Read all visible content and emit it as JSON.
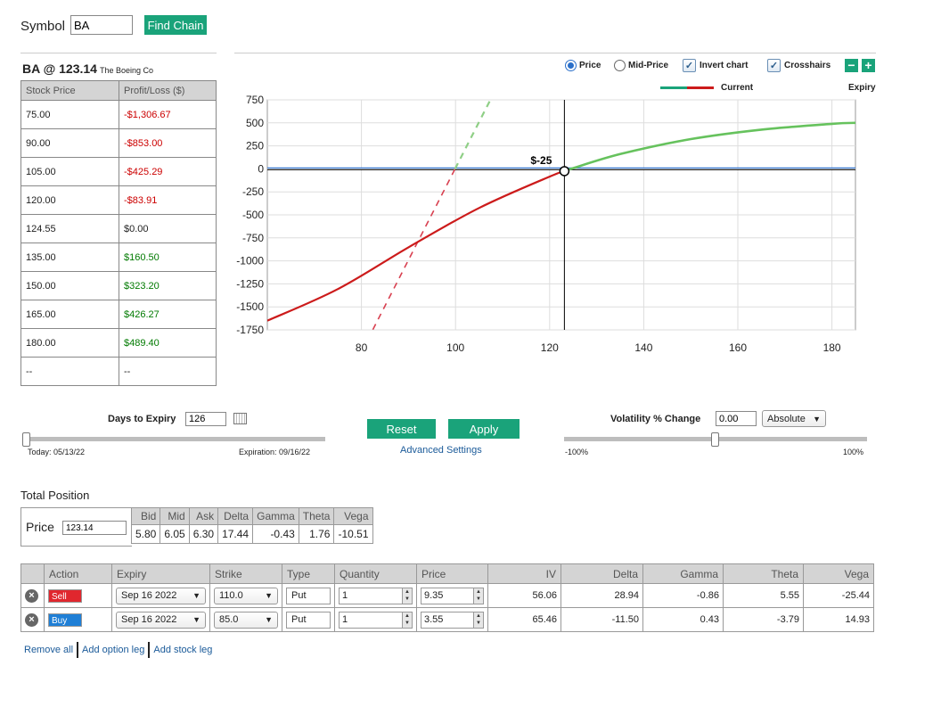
{
  "symbol": {
    "label": "Symbol",
    "value": "BA",
    "find_button": "Find Chain"
  },
  "quote": {
    "ticker_price": "BA @ 123.14",
    "company": "The Boeing Co"
  },
  "pl_table": {
    "headers": [
      "Stock Price",
      "Profit/Loss ($)"
    ],
    "rows": [
      {
        "price": "75.00",
        "pl": "-$1,306.67",
        "sign": "neg"
      },
      {
        "price": "90.00",
        "pl": "-$853.00",
        "sign": "neg"
      },
      {
        "price": "105.00",
        "pl": "-$425.29",
        "sign": "neg"
      },
      {
        "price": "120.00",
        "pl": "-$83.91",
        "sign": "neg"
      },
      {
        "price": "124.55",
        "pl": "$0.00",
        "sign": "zero"
      },
      {
        "price": "135.00",
        "pl": "$160.50",
        "sign": "pos"
      },
      {
        "price": "150.00",
        "pl": "$323.20",
        "sign": "pos"
      },
      {
        "price": "165.00",
        "pl": "$426.27",
        "sign": "pos"
      },
      {
        "price": "180.00",
        "pl": "$489.40",
        "sign": "pos"
      },
      {
        "price": "--",
        "pl": "--",
        "sign": "zero"
      }
    ]
  },
  "chart_controls": {
    "price_radio": "Price",
    "mid_price_radio": "Mid-Price",
    "invert_chart": "Invert chart",
    "crosshairs": "Crosshairs",
    "legend_current": "Current",
    "legend_expiry": "Expiry",
    "colors": {
      "current_loss": "#cc1b1b",
      "current_gain": "#66c25d",
      "expiry_loss": "#d84050",
      "expiry_gain": "#8fcf86",
      "zero_line": "#3a7bd5",
      "accent": "#1aa37a"
    }
  },
  "chart_data": {
    "type": "line",
    "xlim": [
      60,
      185
    ],
    "ylim": [
      -1750,
      750
    ],
    "x_ticks": [
      80,
      100,
      120,
      140,
      160,
      180
    ],
    "y_ticks": [
      750,
      500,
      250,
      0,
      -250,
      -500,
      -750,
      -1000,
      -1250,
      -1500,
      -1750
    ],
    "series": [
      {
        "name": "Current",
        "x": [
          60,
          75,
          90,
          105,
          120,
          123.14,
          124.55,
          135,
          150,
          165,
          180,
          185
        ],
        "y": [
          -1650,
          -1306.67,
          -853,
          -425.29,
          -83.91,
          -25,
          0,
          160.5,
          323.2,
          426.27,
          489.4,
          500
        ]
      },
      {
        "name": "Expiry",
        "x": [
          60,
          85,
          110,
          185
        ],
        "y": [
          -3990,
          -1490,
          1010,
          1010
        ]
      }
    ],
    "crosshair": {
      "x": 123.14,
      "y": -25,
      "label": "$-25"
    }
  },
  "days_to_expiry": {
    "label": "Days to Expiry",
    "value": "126",
    "today": "Today: 05/13/22",
    "expiration": "Expiration: 09/16/22",
    "slider_fraction": 0
  },
  "buttons": {
    "reset": "Reset",
    "apply": "Apply",
    "advanced": "Advanced Settings"
  },
  "volatility": {
    "label": "Volatility % Change",
    "value": "0.00",
    "mode": "Absolute",
    "min_label": "-100%",
    "max_label": "100%",
    "slider_fraction": 0.5
  },
  "total_position": {
    "title": "Total Position",
    "price_label": "Price",
    "price_value": "123.14",
    "greek_headers": [
      "Bid",
      "Mid",
      "Ask",
      "Delta",
      "Gamma",
      "Theta",
      "Vega"
    ],
    "greek_values": [
      "5.80",
      "6.05",
      "6.30",
      "17.44",
      "-0.43",
      "1.76",
      "-10.51"
    ]
  },
  "legs": {
    "headers": [
      "",
      "Action",
      "Expiry",
      "Strike",
      "Type",
      "Quantity",
      "Price",
      "IV",
      "Delta",
      "Gamma",
      "Theta",
      "Vega"
    ],
    "rows": [
      {
        "action": "Sell",
        "expiry": "Sep 16 2022",
        "strike": "110.0",
        "type": "Put",
        "qty": "1",
        "price": "9.35",
        "iv": "56.06",
        "delta": "28.94",
        "gamma": "-0.86",
        "theta": "5.55",
        "vega": "-25.44"
      },
      {
        "action": "Buy",
        "expiry": "Sep 16 2022",
        "strike": "85.0",
        "type": "Put",
        "qty": "1",
        "price": "3.55",
        "iv": "65.46",
        "delta": "-11.50",
        "gamma": "0.43",
        "theta": "-3.79",
        "vega": "14.93"
      }
    ]
  },
  "footer_links": {
    "remove_all": "Remove all",
    "add_option": "Add option leg",
    "add_stock": "Add stock leg"
  }
}
